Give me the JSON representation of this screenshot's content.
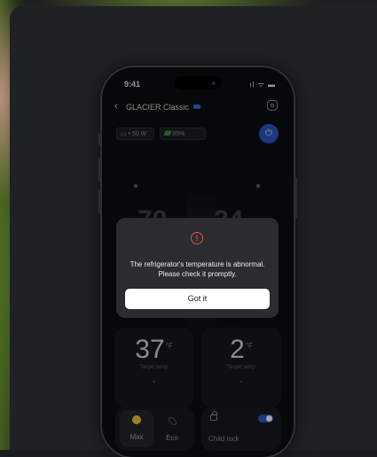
{
  "status_bar": {
    "time": "9:41",
    "icons_text": "ıl ᯤ ▬"
  },
  "header": {
    "back_glyph": "‹",
    "title": "GLACIER Classic"
  },
  "chips": {
    "battery_text": "▭ • 50 W",
    "charge_bars": "/////",
    "charge_percent": "85%"
  },
  "power_glyph": "⏻",
  "zones": [
    {
      "target_temp": "37",
      "unit": "°F",
      "label": "Target temp",
      "chevron": "⌄"
    },
    {
      "target_temp": "2",
      "unit": "°F",
      "label": "Target temp",
      "chevron": "⌄"
    }
  ],
  "modes": [
    {
      "label": "Max",
      "icon": "bolt-icon",
      "selected": true
    },
    {
      "label": "Eco",
      "icon": "leaf-icon",
      "selected": false
    }
  ],
  "child_lock": {
    "label": "Child lock",
    "enabled": true
  },
  "dialog": {
    "icon": "alert-icon",
    "icon_glyph": "!",
    "message": "The refrigerator's temperature is abnormal. Please check it promptly.",
    "button_label": "Got it"
  },
  "colors": {
    "accent_blue": "#2f55c8",
    "alert_red": "#e2543b",
    "max_yellow": "#f1c53a",
    "charge_green": "#5fd25a"
  }
}
